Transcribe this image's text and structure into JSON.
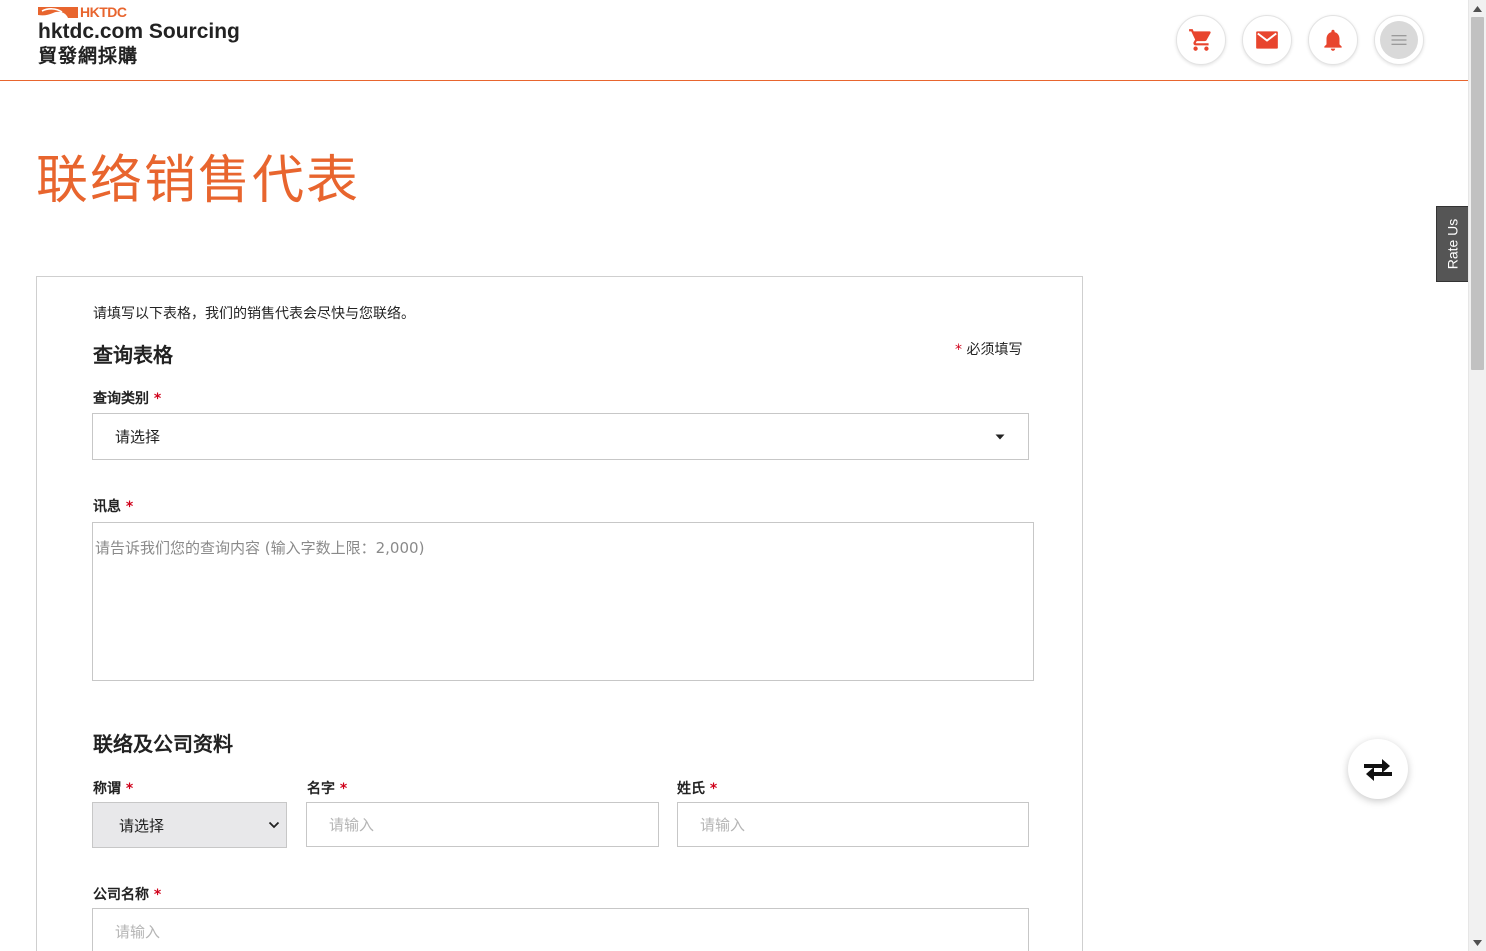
{
  "header": {
    "brand_short": "HKTDC",
    "brand_en": "hktdc.com Sourcing",
    "brand_zh": "貿發網採購",
    "icons": [
      "cart-icon",
      "mail-icon",
      "bell-icon",
      "menu-icon"
    ]
  },
  "page": {
    "title": "联络销售代表"
  },
  "form": {
    "intro": "请填写以下表格，我们的销售代表会尽快与您联络。",
    "section1_title": "查询表格",
    "required_star": "*",
    "required_note": "必须填写",
    "category_label": "查询类别",
    "category_value": "请选择",
    "message_label": "讯息",
    "message_placeholder": "请告诉我们您的查询内容 (输入字数上限：2,000)",
    "section2_title": "联络及公司资料",
    "salutation_label": "称谓",
    "salutation_value": "请选择",
    "first_name_label": "名字",
    "first_name_placeholder": "请输入",
    "last_name_label": "姓氏",
    "last_name_placeholder": "请输入",
    "company_label": "公司名称",
    "company_placeholder": "请输入"
  },
  "side": {
    "rate_us": "Rate Us",
    "compare_icon": "compare-arrows-icon"
  },
  "colors": {
    "accent": "#e8652e",
    "required": "#d0021b"
  }
}
